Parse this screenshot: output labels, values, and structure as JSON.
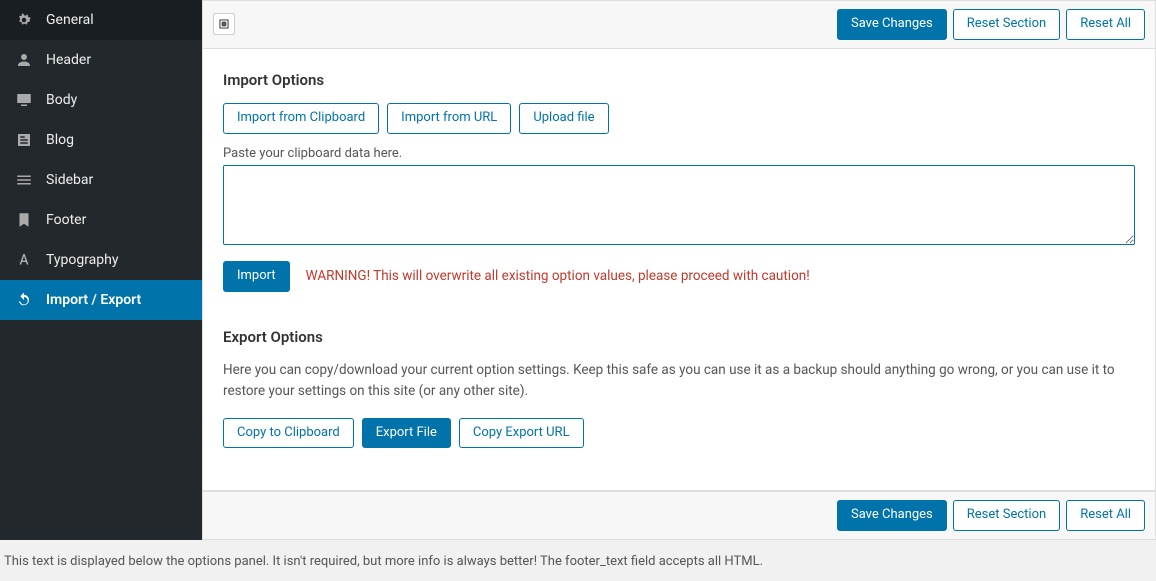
{
  "sidebar": {
    "items": [
      {
        "label": "General"
      },
      {
        "label": "Header"
      },
      {
        "label": "Body"
      },
      {
        "label": "Blog"
      },
      {
        "label": "Sidebar"
      },
      {
        "label": "Footer"
      },
      {
        "label": "Typography"
      },
      {
        "label": "Import / Export"
      }
    ]
  },
  "toolbar": {
    "save": "Save Changes",
    "reset_section": "Reset Section",
    "reset_all": "Reset All"
  },
  "import_section": {
    "title": "Import Options",
    "btn_clipboard": "Import from Clipboard",
    "btn_url": "Import from URL",
    "btn_upload": "Upload file",
    "hint": "Paste your clipboard data here.",
    "btn_import": "Import",
    "warning": "WARNING! This will overwrite all existing option values, please proceed with caution!"
  },
  "export_section": {
    "title": "Export Options",
    "desc": "Here you can copy/download your current option settings. Keep this safe as you can use it as a backup should anything go wrong, or you can use it to restore your settings on this site (or any other site).",
    "btn_copy": "Copy to Clipboard",
    "btn_export": "Export File",
    "btn_copy_url": "Copy Export URL"
  },
  "footer_note": "This text is displayed below the options panel. It isn't required, but more info is always better! The footer_text field accepts all HTML."
}
